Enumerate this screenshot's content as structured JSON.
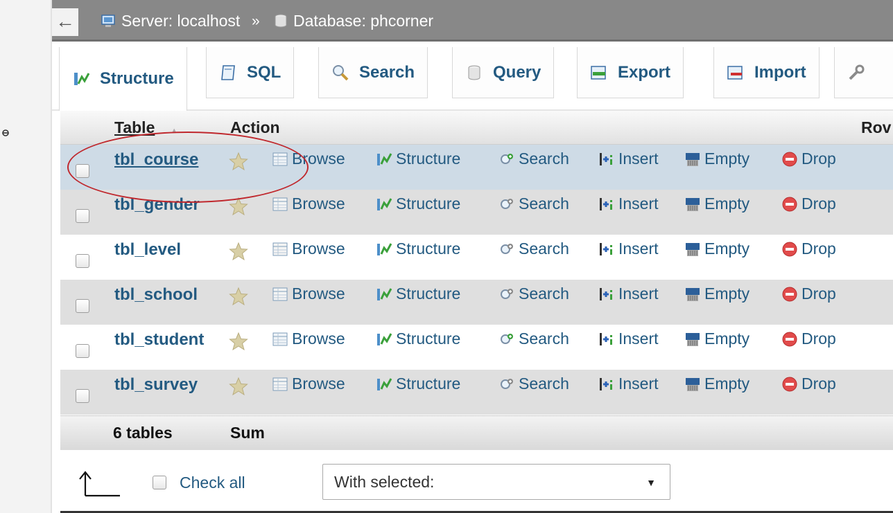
{
  "topbar": {
    "back": "←",
    "server_label": "Server: localhost",
    "separator": "»",
    "database_label": "Database: phcorner"
  },
  "tabs": [
    {
      "label": "Structure",
      "icon": "structure-icon",
      "active": true
    },
    {
      "label": "SQL",
      "icon": "sql-icon"
    },
    {
      "label": "Search",
      "icon": "search-icon"
    },
    {
      "label": "Query",
      "icon": "query-icon"
    },
    {
      "label": "Export",
      "icon": "export-icon"
    },
    {
      "label": "Import",
      "icon": "import-icon"
    }
  ],
  "table": {
    "headers": {
      "table": "Table",
      "action": "Action",
      "rows": "Rov"
    },
    "sort_indicator": "▲",
    "actions": {
      "browse": "Browse",
      "structure": "Structure",
      "search": "Search",
      "insert": "Insert",
      "empty": "Empty",
      "drop": "Drop"
    },
    "rows": [
      {
        "name": "tbl_course"
      },
      {
        "name": "tbl_gender"
      },
      {
        "name": "tbl_level"
      },
      {
        "name": "tbl_school"
      },
      {
        "name": "tbl_student"
      },
      {
        "name": "tbl_survey"
      }
    ],
    "footer": {
      "count": "6 tables",
      "sum": "Sum"
    }
  },
  "bottom": {
    "check_all": "Check all",
    "with_selected": "With selected:",
    "caret": "▼"
  },
  "colors": {
    "link": "#235a81",
    "highlight_row": "#cedbe6",
    "annotation": "#c0282d"
  }
}
